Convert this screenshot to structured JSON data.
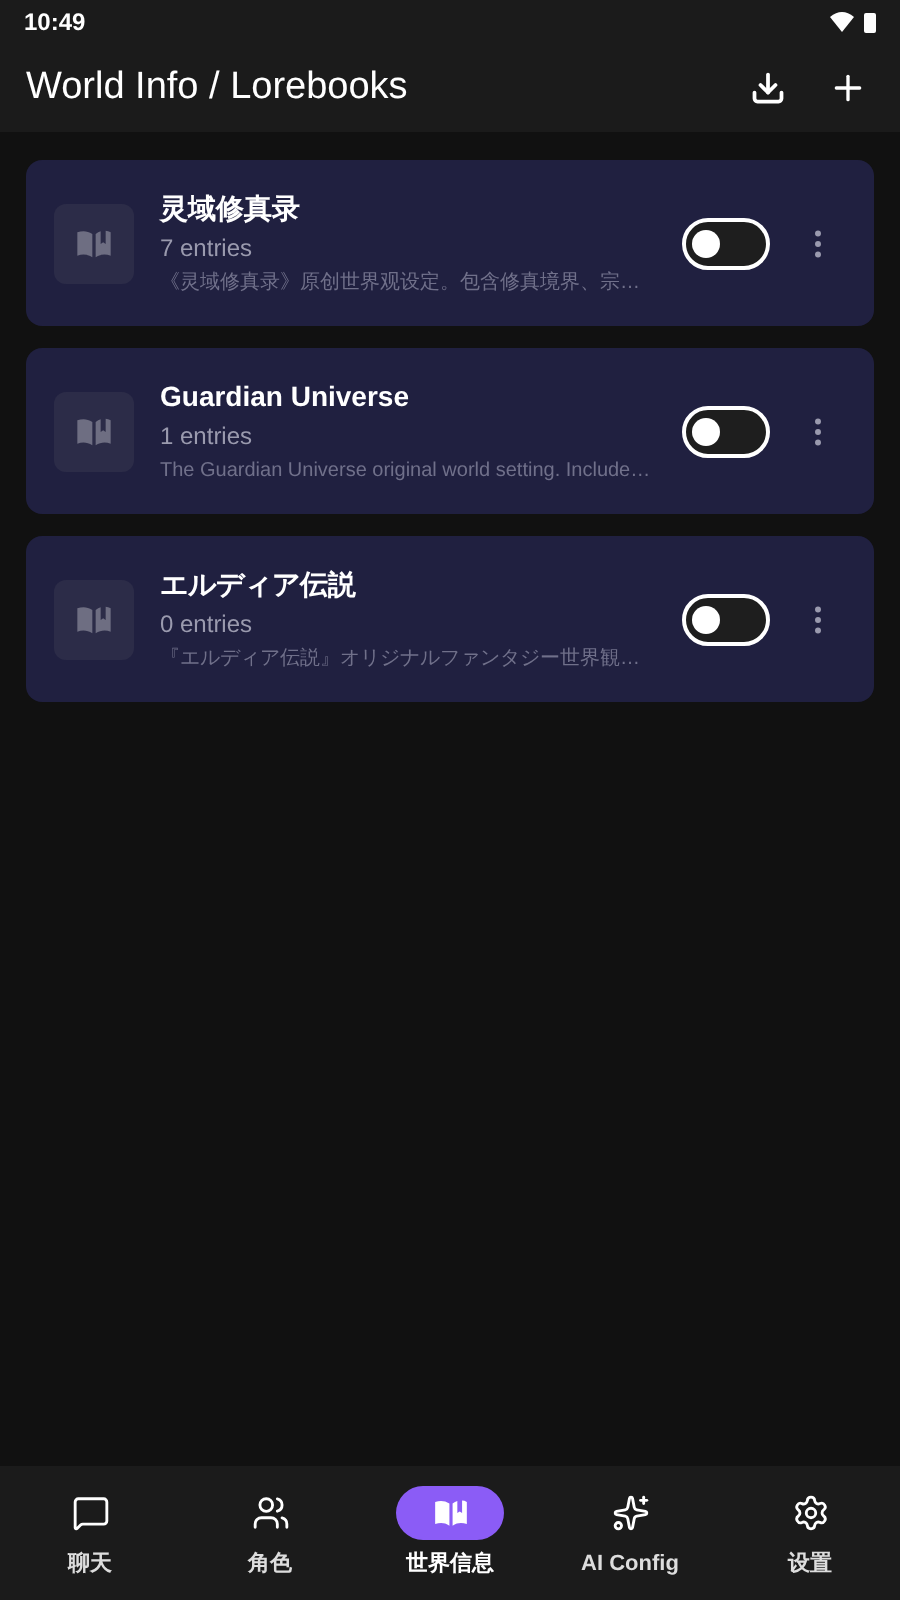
{
  "status_bar": {
    "time": "10:49"
  },
  "app_bar": {
    "title": "World Info / Lorebooks"
  },
  "lorebooks": [
    {
      "name": "灵域修真录",
      "entries": "7 entries",
      "description": "《灵域修真录》原创世界观设定。包含修真境界、宗…",
      "on": false
    },
    {
      "name": "Guardian Universe",
      "entries": "1 entries",
      "description": "The Guardian Universe original world setting. Include…",
      "on": false
    },
    {
      "name": "エルディア伝説",
      "entries": "0 entries",
      "description": "『エルディア伝説』オリジナルファンタジー世界観…",
      "on": false
    }
  ],
  "nav": [
    {
      "kind": "chat",
      "label": "聊天",
      "selected": false
    },
    {
      "kind": "characters",
      "label": "角色",
      "selected": false
    },
    {
      "kind": "world",
      "label": "世界信息",
      "selected": true
    },
    {
      "kind": "ai",
      "label": "AI Config",
      "selected": false
    },
    {
      "kind": "settings",
      "label": "设置",
      "selected": false
    }
  ]
}
